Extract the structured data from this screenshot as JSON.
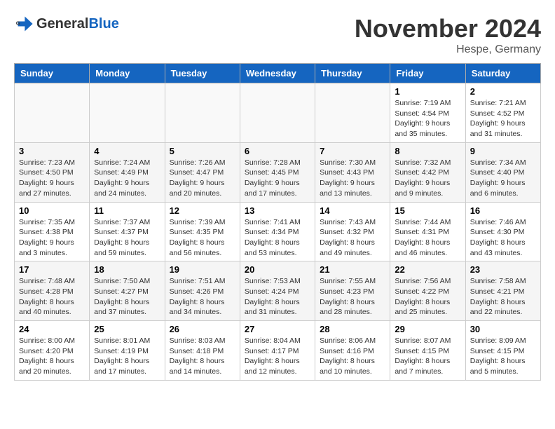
{
  "logo": {
    "text_general": "General",
    "text_blue": "Blue"
  },
  "title": "November 2024",
  "location": "Hespe, Germany",
  "days_of_week": [
    "Sunday",
    "Monday",
    "Tuesday",
    "Wednesday",
    "Thursday",
    "Friday",
    "Saturday"
  ],
  "weeks": [
    [
      {
        "day": "",
        "info": ""
      },
      {
        "day": "",
        "info": ""
      },
      {
        "day": "",
        "info": ""
      },
      {
        "day": "",
        "info": ""
      },
      {
        "day": "",
        "info": ""
      },
      {
        "day": "1",
        "info": "Sunrise: 7:19 AM\nSunset: 4:54 PM\nDaylight: 9 hours\nand 35 minutes."
      },
      {
        "day": "2",
        "info": "Sunrise: 7:21 AM\nSunset: 4:52 PM\nDaylight: 9 hours\nand 31 minutes."
      }
    ],
    [
      {
        "day": "3",
        "info": "Sunrise: 7:23 AM\nSunset: 4:50 PM\nDaylight: 9 hours\nand 27 minutes."
      },
      {
        "day": "4",
        "info": "Sunrise: 7:24 AM\nSunset: 4:49 PM\nDaylight: 9 hours\nand 24 minutes."
      },
      {
        "day": "5",
        "info": "Sunrise: 7:26 AM\nSunset: 4:47 PM\nDaylight: 9 hours\nand 20 minutes."
      },
      {
        "day": "6",
        "info": "Sunrise: 7:28 AM\nSunset: 4:45 PM\nDaylight: 9 hours\nand 17 minutes."
      },
      {
        "day": "7",
        "info": "Sunrise: 7:30 AM\nSunset: 4:43 PM\nDaylight: 9 hours\nand 13 minutes."
      },
      {
        "day": "8",
        "info": "Sunrise: 7:32 AM\nSunset: 4:42 PM\nDaylight: 9 hours\nand 9 minutes."
      },
      {
        "day": "9",
        "info": "Sunrise: 7:34 AM\nSunset: 4:40 PM\nDaylight: 9 hours\nand 6 minutes."
      }
    ],
    [
      {
        "day": "10",
        "info": "Sunrise: 7:35 AM\nSunset: 4:38 PM\nDaylight: 9 hours\nand 3 minutes."
      },
      {
        "day": "11",
        "info": "Sunrise: 7:37 AM\nSunset: 4:37 PM\nDaylight: 8 hours\nand 59 minutes."
      },
      {
        "day": "12",
        "info": "Sunrise: 7:39 AM\nSunset: 4:35 PM\nDaylight: 8 hours\nand 56 minutes."
      },
      {
        "day": "13",
        "info": "Sunrise: 7:41 AM\nSunset: 4:34 PM\nDaylight: 8 hours\nand 53 minutes."
      },
      {
        "day": "14",
        "info": "Sunrise: 7:43 AM\nSunset: 4:32 PM\nDaylight: 8 hours\nand 49 minutes."
      },
      {
        "day": "15",
        "info": "Sunrise: 7:44 AM\nSunset: 4:31 PM\nDaylight: 8 hours\nand 46 minutes."
      },
      {
        "day": "16",
        "info": "Sunrise: 7:46 AM\nSunset: 4:30 PM\nDaylight: 8 hours\nand 43 minutes."
      }
    ],
    [
      {
        "day": "17",
        "info": "Sunrise: 7:48 AM\nSunset: 4:28 PM\nDaylight: 8 hours\nand 40 minutes."
      },
      {
        "day": "18",
        "info": "Sunrise: 7:50 AM\nSunset: 4:27 PM\nDaylight: 8 hours\nand 37 minutes."
      },
      {
        "day": "19",
        "info": "Sunrise: 7:51 AM\nSunset: 4:26 PM\nDaylight: 8 hours\nand 34 minutes."
      },
      {
        "day": "20",
        "info": "Sunrise: 7:53 AM\nSunset: 4:24 PM\nDaylight: 8 hours\nand 31 minutes."
      },
      {
        "day": "21",
        "info": "Sunrise: 7:55 AM\nSunset: 4:23 PM\nDaylight: 8 hours\nand 28 minutes."
      },
      {
        "day": "22",
        "info": "Sunrise: 7:56 AM\nSunset: 4:22 PM\nDaylight: 8 hours\nand 25 minutes."
      },
      {
        "day": "23",
        "info": "Sunrise: 7:58 AM\nSunset: 4:21 PM\nDaylight: 8 hours\nand 22 minutes."
      }
    ],
    [
      {
        "day": "24",
        "info": "Sunrise: 8:00 AM\nSunset: 4:20 PM\nDaylight: 8 hours\nand 20 minutes."
      },
      {
        "day": "25",
        "info": "Sunrise: 8:01 AM\nSunset: 4:19 PM\nDaylight: 8 hours\nand 17 minutes."
      },
      {
        "day": "26",
        "info": "Sunrise: 8:03 AM\nSunset: 4:18 PM\nDaylight: 8 hours\nand 14 minutes."
      },
      {
        "day": "27",
        "info": "Sunrise: 8:04 AM\nSunset: 4:17 PM\nDaylight: 8 hours\nand 12 minutes."
      },
      {
        "day": "28",
        "info": "Sunrise: 8:06 AM\nSunset: 4:16 PM\nDaylight: 8 hours\nand 10 minutes."
      },
      {
        "day": "29",
        "info": "Sunrise: 8:07 AM\nSunset: 4:15 PM\nDaylight: 8 hours\nand 7 minutes."
      },
      {
        "day": "30",
        "info": "Sunrise: 8:09 AM\nSunset: 4:15 PM\nDaylight: 8 hours\nand 5 minutes."
      }
    ]
  ]
}
